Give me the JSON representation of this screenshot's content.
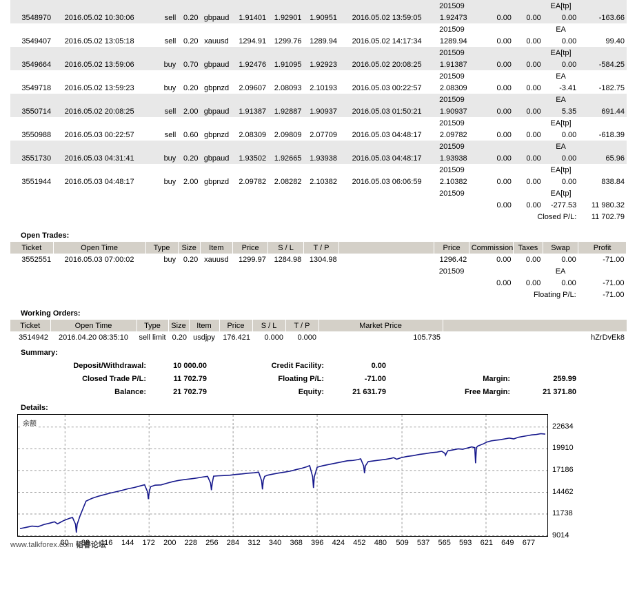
{
  "closed_trades": {
    "rows": [
      {
        "comment_top": "201509",
        "comment_top_right": "EA[tp]",
        "ticket": "3548970",
        "open_time": "2016.05.02 10:30:06",
        "type": "sell",
        "size": "0.20",
        "item": "gbpaud",
        "price": "1.91401",
        "sl": "1.92901",
        "tp": "1.90951",
        "close_time": "2016.05.02 13:59:05",
        "close_price": "1.92473",
        "commission": "0.00",
        "taxes": "0.00",
        "swap": "0.00",
        "profit": "-163.66",
        "striped": true
      },
      {
        "comment_top": "201509",
        "comment_top_right": "EA",
        "ticket": "3549407",
        "open_time": "2016.05.02 13:05:18",
        "type": "sell",
        "size": "0.20",
        "item": "xauusd",
        "price": "1294.91",
        "sl": "1299.76",
        "tp": "1289.94",
        "close_time": "2016.05.02 14:17:34",
        "close_price": "1289.94",
        "commission": "0.00",
        "taxes": "0.00",
        "swap": "0.00",
        "profit": "99.40",
        "striped": false
      },
      {
        "comment_top": "201509",
        "comment_top_right": "EA[tp]",
        "ticket": "3549664",
        "open_time": "2016.05.02 13:59:06",
        "type": "buy",
        "size": "0.70",
        "item": "gbpaud",
        "price": "1.92476",
        "sl": "1.91095",
        "tp": "1.92923",
        "close_time": "2016.05.02 20:08:25",
        "close_price": "1.91387",
        "commission": "0.00",
        "taxes": "0.00",
        "swap": "0.00",
        "profit": "-584.25",
        "striped": true
      },
      {
        "comment_top": "201509",
        "comment_top_right": "EA",
        "ticket": "3549718",
        "open_time": "2016.05.02 13:59:23",
        "type": "buy",
        "size": "0.20",
        "item": "gbpnzd",
        "price": "2.09607",
        "sl": "2.08093",
        "tp": "2.10193",
        "close_time": "2016.05.03 00:22:57",
        "close_price": "2.08309",
        "commission": "0.00",
        "taxes": "0.00",
        "swap": "-3.41",
        "profit": "-182.75",
        "striped": false
      },
      {
        "comment_top": "201509",
        "comment_top_right": "EA",
        "ticket": "3550714",
        "open_time": "2016.05.02 20:08:25",
        "type": "sell",
        "size": "2.00",
        "item": "gbpaud",
        "price": "1.91387",
        "sl": "1.92887",
        "tp": "1.90937",
        "close_time": "2016.05.03 01:50:21",
        "close_price": "1.90937",
        "commission": "0.00",
        "taxes": "0.00",
        "swap": "5.35",
        "profit": "691.44",
        "striped": true
      },
      {
        "comment_top": "201509",
        "comment_top_right": "EA[tp]",
        "ticket": "3550988",
        "open_time": "2016.05.03 00:22:57",
        "type": "sell",
        "size": "0.60",
        "item": "gbpnzd",
        "price": "2.08309",
        "sl": "2.09809",
        "tp": "2.07709",
        "close_time": "2016.05.03 04:48:17",
        "close_price": "2.09782",
        "commission": "0.00",
        "taxes": "0.00",
        "swap": "0.00",
        "profit": "-618.39",
        "striped": false
      },
      {
        "comment_top": "201509",
        "comment_top_right": "EA",
        "ticket": "3551730",
        "open_time": "2016.05.03 04:31:41",
        "type": "buy",
        "size": "0.20",
        "item": "gbpaud",
        "price": "1.93502",
        "sl": "1.92665",
        "tp": "1.93938",
        "close_time": "2016.05.03 04:48:17",
        "close_price": "1.93938",
        "commission": "0.00",
        "taxes": "0.00",
        "swap": "0.00",
        "profit": "65.96",
        "striped": true
      },
      {
        "comment_top": "201509",
        "comment_top_right": "EA[tp]",
        "ticket": "3551944",
        "open_time": "2016.05.03 04:48:17",
        "type": "buy",
        "size": "2.00",
        "item": "gbpnzd",
        "price": "2.09782",
        "sl": "2.08282",
        "tp": "2.10382",
        "close_time": "2016.05.03 06:06:59",
        "close_price": "2.10382",
        "commission": "0.00",
        "taxes": "0.00",
        "swap": "0.00",
        "profit": "838.84",
        "striped": false
      }
    ],
    "tail_comment": "201509",
    "tail_comment_right": "EA[tp]",
    "totals": {
      "commission": "0.00",
      "taxes": "0.00",
      "swap": "-277.53",
      "profit": "11 980.32"
    },
    "closed_pl_label": "Closed P/L:",
    "closed_pl_value": "11 702.79"
  },
  "open_trades": {
    "title": "Open Trades:",
    "columns": [
      "Ticket",
      "Open Time",
      "Type",
      "Size",
      "Item",
      "Price",
      "S / L",
      "T / P",
      "",
      "Price",
      "Commission",
      "Taxes",
      "Swap",
      "Profit"
    ],
    "rows": [
      {
        "ticket": "3552551",
        "open_time": "2016.05.03 07:00:02",
        "type": "buy",
        "size": "0.20",
        "item": "xauusd",
        "price": "1299.97",
        "sl": "1284.98",
        "tp": "1304.98",
        "market_price": "1296.42",
        "commission": "0.00",
        "taxes": "0.00",
        "swap": "0.00",
        "profit": "-71.00"
      }
    ],
    "comment": "201509",
    "comment_right": "EA",
    "totals": {
      "commission": "0.00",
      "taxes": "0.00",
      "swap": "0.00",
      "profit": "-71.00"
    },
    "floating_pl_label": "Floating P/L:",
    "floating_pl_value": "-71.00"
  },
  "working_orders": {
    "title": "Working Orders:",
    "columns": [
      "Ticket",
      "Open Time",
      "Type",
      "Size",
      "Item",
      "Price",
      "S / L",
      "T / P",
      "Market Price",
      ""
    ],
    "rows": [
      {
        "ticket": "3514942",
        "open_time": "2016.04.20 08:35:10",
        "type": "sell limit",
        "size": "0.20",
        "item": "usdjpy",
        "price": "176.421",
        "sl": "0.000",
        "tp": "0.000",
        "market_price": "105.735",
        "comment": "hZrDvEk8"
      }
    ]
  },
  "summary": {
    "title": "Summary:",
    "deposit_label": "Deposit/Withdrawal:",
    "deposit_value": "10 000.00",
    "credit_label": "Credit Facility:",
    "credit_value": "0.00",
    "closed_trade_pl_label": "Closed Trade P/L:",
    "closed_trade_pl_value": "11 702.79",
    "floating_pl_label": "Floating P/L:",
    "floating_pl_value": "-71.00",
    "margin_label": "Margin:",
    "margin_value": "259.99",
    "balance_label": "Balance:",
    "balance_value": "21 702.79",
    "equity_label": "Equity:",
    "equity_value": "21 631.79",
    "free_margin_label": "Free Margin:",
    "free_margin_value": "21 371.80"
  },
  "details": {
    "title": "Details:"
  },
  "watermark": {
    "text_latin": "www.talkforex.com ",
    "text_cn": "韬睿论坛"
  },
  "chart_data": {
    "type": "line",
    "title": "",
    "series_label": "余额",
    "xlabel": "",
    "ylabel": "",
    "grid": true,
    "legend_position": "top-left",
    "line_color": "#16188c",
    "ylim": [
      9014,
      24000
    ],
    "yticks": [
      22634,
      19910,
      17186,
      14462,
      11738,
      9014
    ],
    "xlim": [
      0,
      700
    ],
    "xticks": [
      60,
      88,
      116,
      144,
      172,
      200,
      228,
      256,
      284,
      312,
      340,
      368,
      396,
      424,
      452,
      480,
      509,
      537,
      565,
      593,
      621,
      649,
      677
    ],
    "x": [
      0,
      8,
      16,
      24,
      32,
      40,
      46,
      50,
      54,
      58,
      62,
      66,
      70,
      74,
      80,
      88,
      96,
      104,
      112,
      120,
      128,
      136,
      144,
      152,
      160,
      166,
      170,
      174,
      180,
      188,
      196,
      204,
      212,
      220,
      228,
      236,
      244,
      250,
      254,
      258,
      264,
      272,
      280,
      288,
      296,
      304,
      312,
      318,
      322,
      326,
      330,
      336,
      344,
      352,
      360,
      368,
      376,
      382,
      386,
      390,
      396,
      404,
      412,
      420,
      428,
      436,
      444,
      450,
      454,
      458,
      464,
      472,
      480,
      488,
      494,
      498,
      502,
      508,
      516,
      524,
      532,
      540,
      548,
      556,
      562,
      566,
      570,
      576,
      584,
      590,
      594,
      598,
      602,
      606,
      610,
      614,
      618,
      622,
      628,
      634,
      640,
      646,
      652,
      658,
      664,
      670,
      676,
      682,
      688,
      694,
      700
    ],
    "y": [
      9900,
      10060,
      10220,
      10150,
      10420,
      10600,
      10760,
      10500,
      10700,
      10900,
      11050,
      11200,
      11300,
      10450,
      11500,
      13350,
      13700,
      13950,
      14150,
      14350,
      14520,
      14700,
      14900,
      15050,
      15250,
      15400,
      14500,
      15150,
      15350,
      15380,
      15600,
      15800,
      15950,
      16060,
      16150,
      16250,
      16380,
      16450,
      15600,
      16480,
      16520,
      16560,
      16600,
      16700,
      16760,
      16850,
      16900,
      16980,
      15900,
      16450,
      16600,
      16720,
      16860,
      16980,
      17100,
      17300,
      17480,
      17650,
      17800,
      16400,
      17600,
      17800,
      17950,
      18100,
      18250,
      18400,
      18450,
      18550,
      18650,
      17750,
      18300,
      18400,
      18500,
      18600,
      18700,
      18800,
      18600,
      18800,
      18950,
      19050,
      19200,
      19300,
      19420,
      19500,
      19600,
      19350,
      19650,
      19750,
      19900,
      19850,
      19950,
      20050,
      20150,
      20050,
      20250,
      20400,
      20550,
      20750,
      20900,
      20980,
      21050,
      21150,
      21250,
      21150,
      21350,
      21450,
      21550,
      21650,
      21700,
      21800,
      21750
    ],
    "drawdowns": [
      {
        "x": 74,
        "depth": 1050
      },
      {
        "x": 170,
        "depth": 900
      },
      {
        "x": 254,
        "depth": 880
      },
      {
        "x": 322,
        "depth": 1080
      },
      {
        "x": 390,
        "depth": 1400
      },
      {
        "x": 458,
        "depth": 900
      },
      {
        "x": 566,
        "depth": 250
      },
      {
        "x": 606,
        "depth": 1950
      }
    ],
    "end_balance": 21702.79,
    "start_balance": 10000.0
  }
}
